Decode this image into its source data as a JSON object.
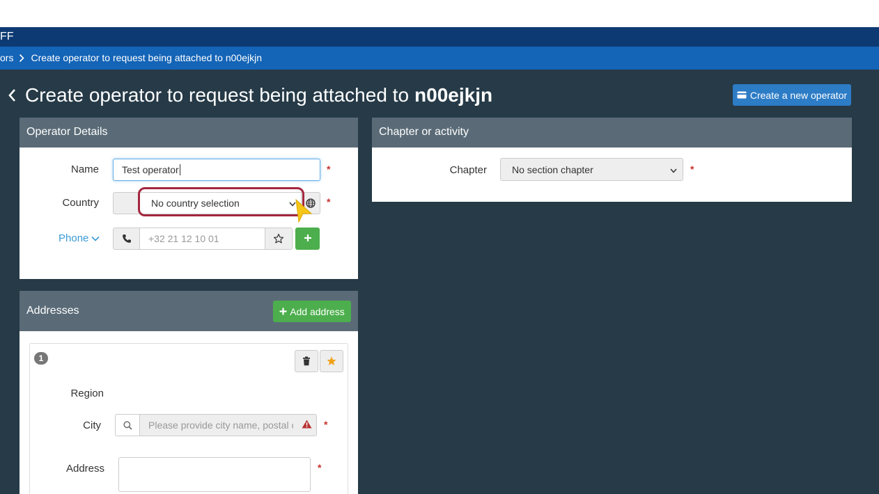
{
  "app": {
    "title_fragment": "FF"
  },
  "breadcrumb": {
    "prev_fragment": "ors",
    "current": "Create operator to request being attached to n00ejkjn"
  },
  "page": {
    "title_prefix": "Create operator to request being attached to",
    "title_entity": "n00ejkjn",
    "create_button": "Create a new operator"
  },
  "operator_details": {
    "heading": "Operator Details",
    "name_label": "Name",
    "name_value": "Test operator",
    "country_label": "Country",
    "country_value": "No country selection",
    "phone_label": "Phone",
    "phone_placeholder": "+32 21 12 10 01",
    "required_mark": "*"
  },
  "chapter": {
    "heading": "Chapter or activity",
    "label": "Chapter",
    "value": "No section chapter",
    "required_mark": "*"
  },
  "addresses": {
    "heading": "Addresses",
    "add_button": "Add address",
    "card_number": "1",
    "region_label": "Region",
    "city_label": "City",
    "city_placeholder": "Please provide city name, postal cc",
    "address_label": "Address",
    "required_mark": "*"
  },
  "colors": {
    "appbar": "#0e3a73",
    "breadbar": "#1464b7",
    "main_bg": "#263a47",
    "panel_head": "#5a6b77",
    "primary": "#2d7cc6",
    "success": "#4cae4c",
    "highlight": "#a3273f",
    "cursor": "#f5c518"
  }
}
